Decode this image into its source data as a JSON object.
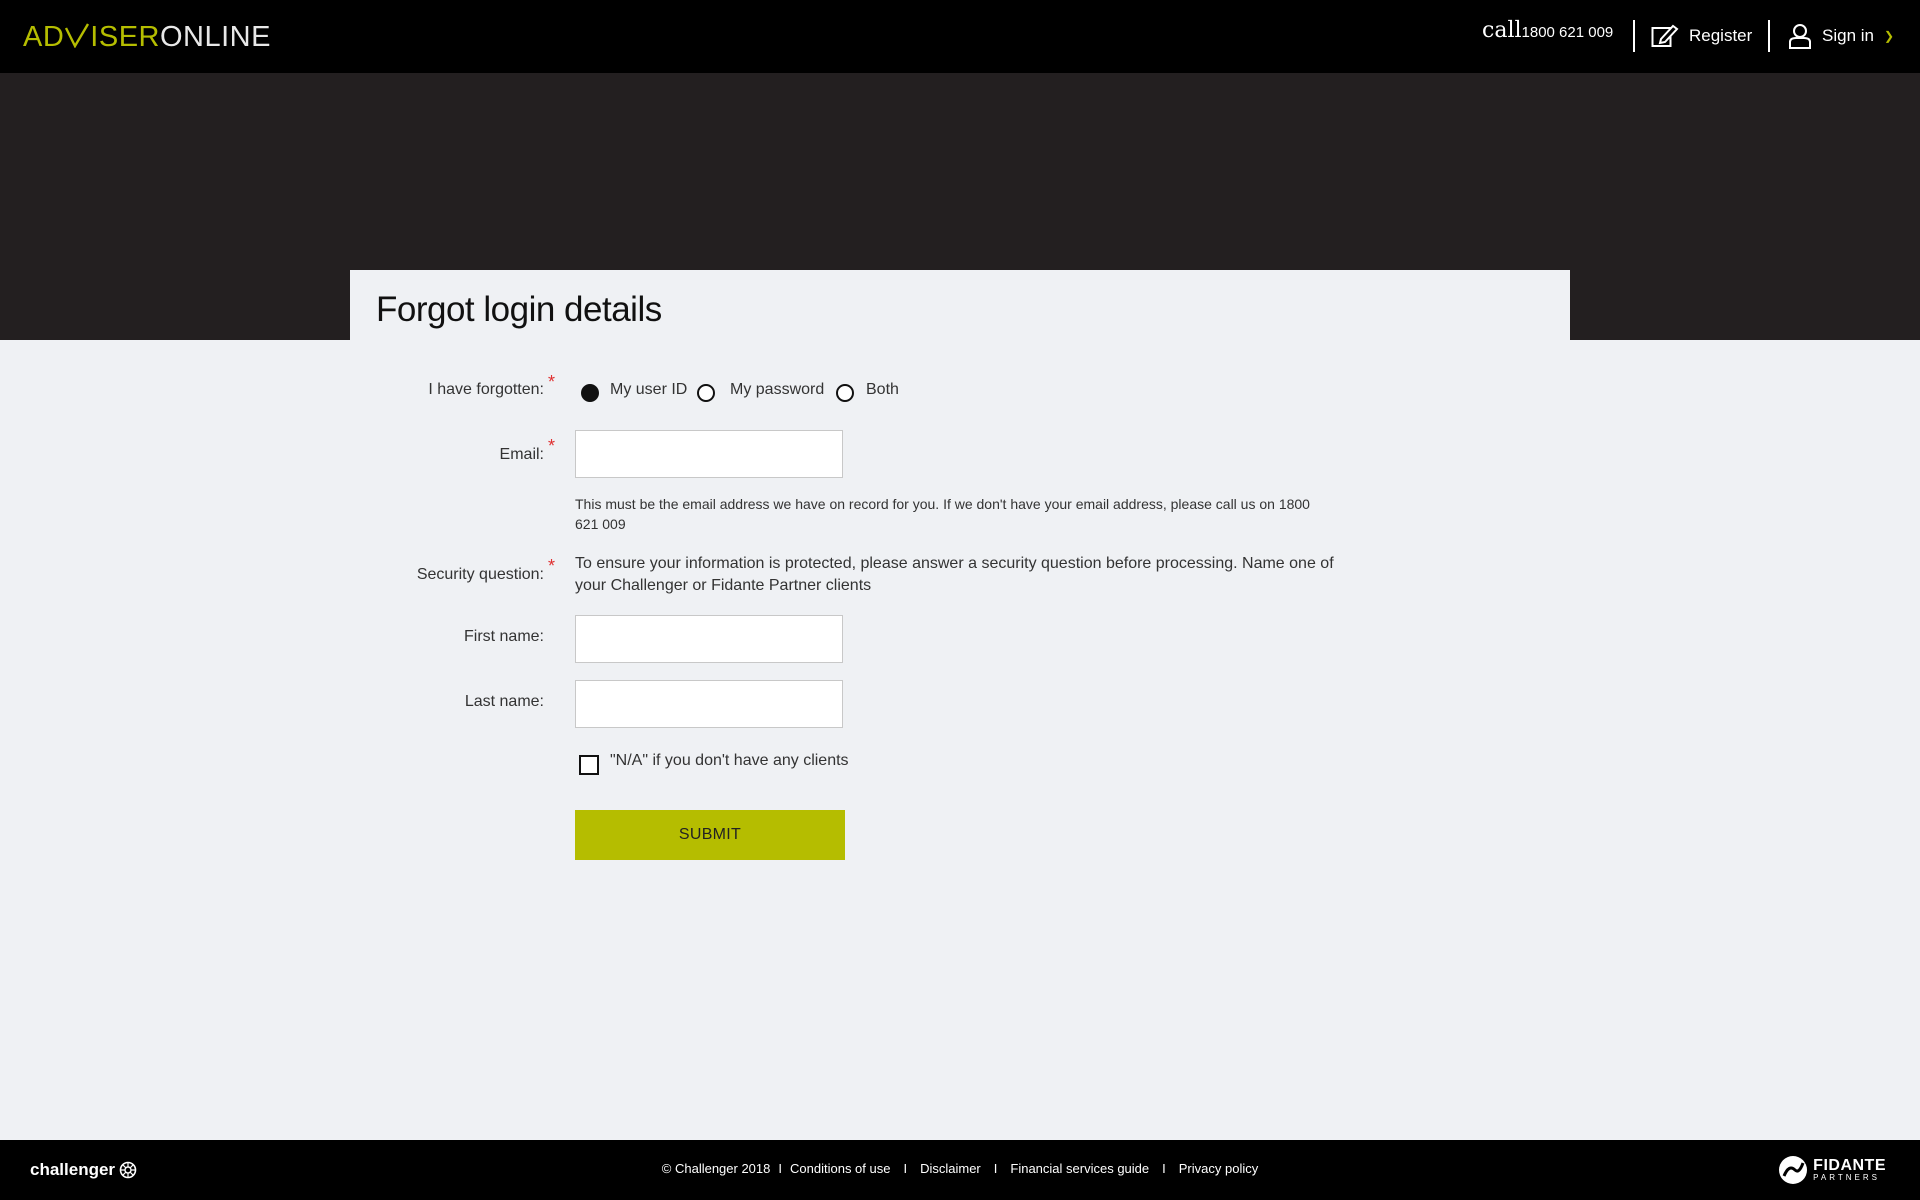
{
  "header": {
    "logo_part1": "AD",
    "logo_part2": "ISER",
    "logo_part3": "ONLINE",
    "call_word": "call",
    "phone": "1800 621 009",
    "register_label": "Register",
    "signin_label": "Sign in"
  },
  "page": {
    "title": "Forgot login details"
  },
  "form": {
    "forgotten_label": "I have forgotten:",
    "options": [
      "My user ID",
      "My password",
      "Both"
    ],
    "selected_option": "My user ID",
    "email_label": "Email:",
    "email_value": "",
    "email_help": "This must be the email address we have on record for you. If we don't have your email address, please call us on 1800 621 009",
    "security_label": "Security question:",
    "security_text": "To ensure your information is protected, please answer a security question before processing. Name one of your Challenger or Fidante Partner clients",
    "first_name_label": "First name:",
    "first_name_value": "",
    "last_name_label": "Last name:",
    "last_name_value": "",
    "na_checkbox_label": "\"N/A\" if you don't have any clients",
    "na_checked": false,
    "submit_label": "SUBMIT",
    "required_mark": "*"
  },
  "footer": {
    "brand": "challenger",
    "copyright": "© Challenger 2018",
    "links": [
      "Conditions of use",
      "Disclaimer",
      "Financial services guide",
      "Privacy policy"
    ],
    "partner_name": "FIDANTE",
    "partner_sub": "PARTNERS"
  },
  "colors": {
    "accent": "#b5bd00",
    "header_bg": "#000000",
    "hero_bg": "#231f20",
    "page_bg": "#eff1f4",
    "required": "#e03030"
  }
}
